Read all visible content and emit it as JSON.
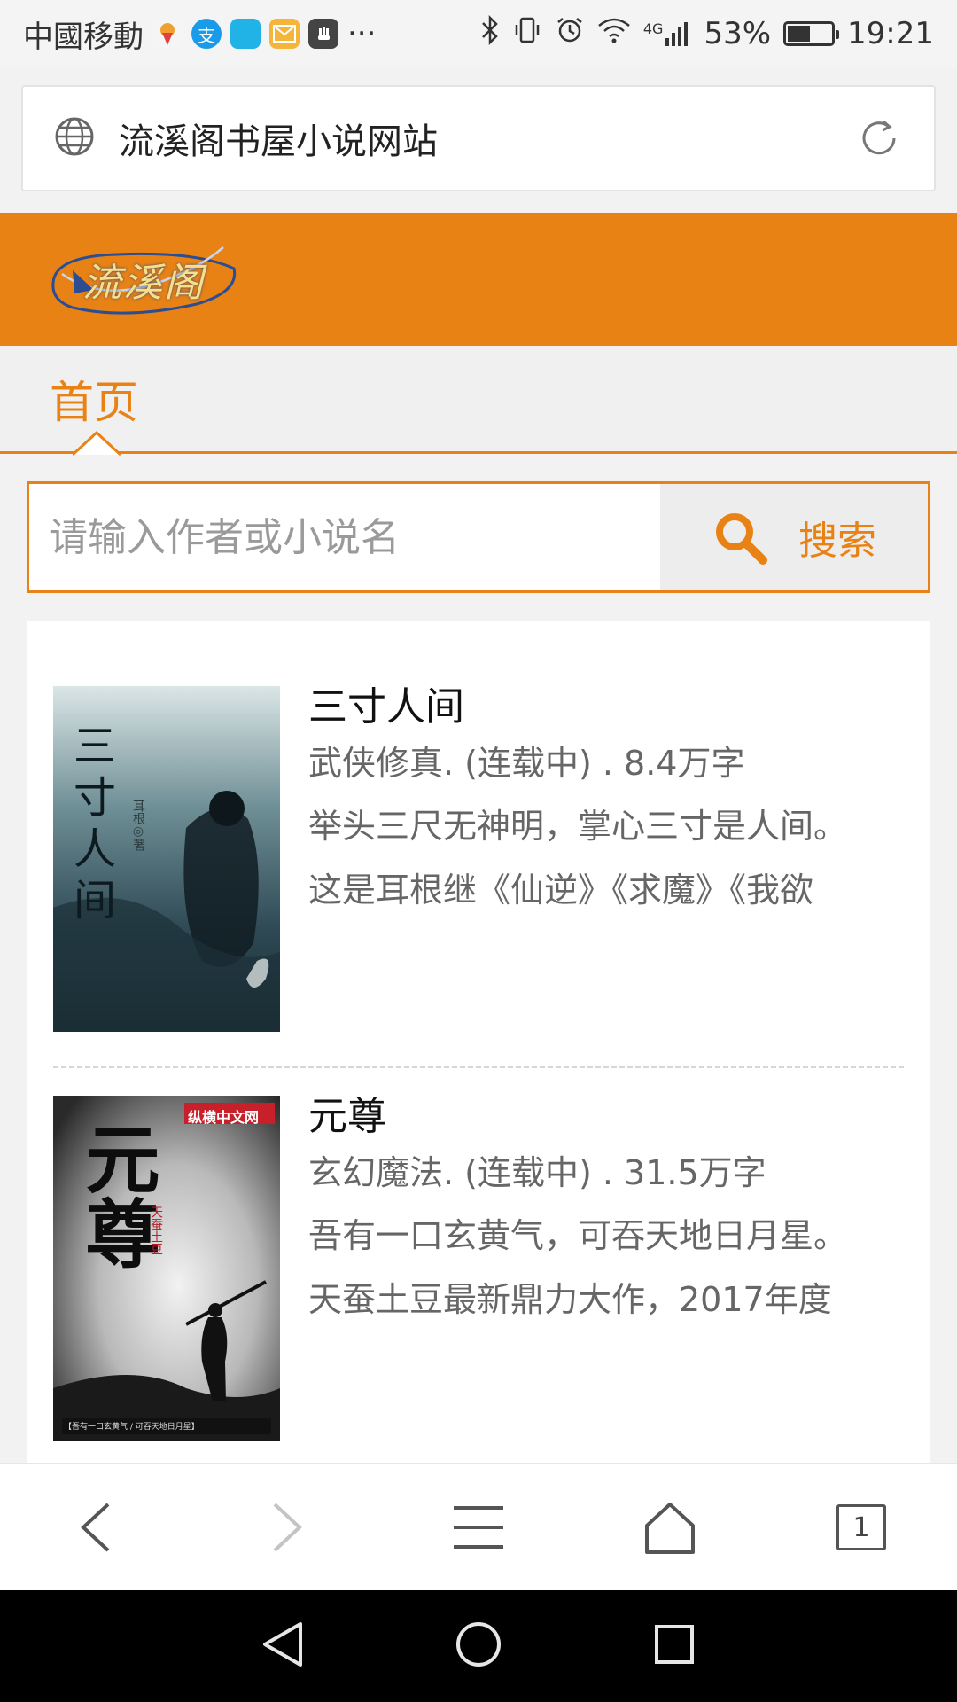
{
  "status_bar": {
    "carrier": "中國移動",
    "notification_icons": [
      {
        "name": "map-pin-notification-icon",
        "color": "#f5f5f5"
      },
      {
        "name": "alipay-notification-icon",
        "color": "#1a9bea"
      },
      {
        "name": "chat-notification-icon",
        "color": "#22b3e6"
      },
      {
        "name": "mail-notification-icon",
        "color": "#f5b53a"
      },
      {
        "name": "hand-notification-icon",
        "color": "#444444"
      }
    ],
    "more": "···",
    "network": "4G",
    "battery": "53%",
    "battery_level": 0.53,
    "time": "19:21"
  },
  "address_bar": {
    "title": "流溪阁书屋小说网站"
  },
  "site": {
    "logo_text": "流溪阁",
    "brand_color": "#e98214"
  },
  "nav": {
    "tabs": [
      {
        "label": "首页",
        "active": true
      }
    ]
  },
  "search": {
    "placeholder": "请输入作者或小说名",
    "value": "",
    "button_label": "搜索"
  },
  "books": [
    {
      "title": "三寸人间",
      "meta": "武侠修真. (连载中) . 8.4万字",
      "desc_lines": [
        "举头三尺无神明，掌心三寸是人间。",
        "这是耳根继《仙逆》《求魔》《我欲"
      ],
      "cover_title": "三寸人间",
      "cover_author": "耳根◎著"
    },
    {
      "title": "元尊",
      "meta": "玄幻魔法. (连载中) . 31.5万字",
      "desc_lines": [
        "吾有一口玄黄气，可吞天地日月星。",
        "天蚕土豆最新鼎力大作，2017年度"
      ],
      "cover_title": "元尊",
      "cover_publisher": "纵横中文网",
      "cover_author": "天蚕土豆",
      "cover_tagline": "【吾有一口玄黄气 / 可吞天地日月星】"
    }
  ],
  "toolbar": {
    "tab_count": "1"
  }
}
